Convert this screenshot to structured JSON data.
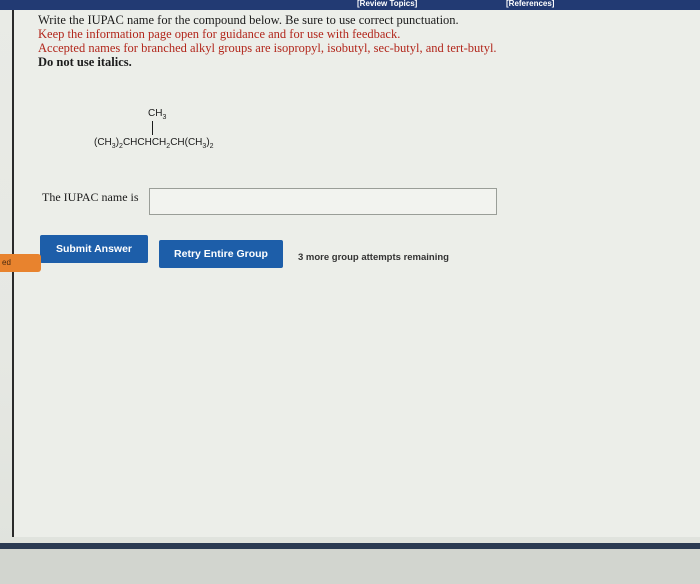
{
  "header": {
    "review_topics": "[Review Topics]",
    "references": "[References]"
  },
  "instructions": {
    "line1": "Write the IUPAC name for the compound below. Be sure to use correct punctuation.",
    "line2": "Keep the information page open for guidance and for use with feedback.",
    "line3": "Accepted names for branched alkyl groups are isopropyl, isobutyl, sec-butyl, and tert-butyl.",
    "line4": "Do not use italics."
  },
  "structure": {
    "branch": "CH3",
    "chain": "(CH3)2CHCHCH2CH(CH3)2"
  },
  "answer": {
    "label": "The IUPAC name is",
    "value": "",
    "placeholder": ""
  },
  "buttons": {
    "submit": "Submit Answer",
    "retry": "Retry Entire Group"
  },
  "attempts_text": "3 more group attempts remaining",
  "side_tab_label": "ed",
  "colors": {
    "top_bar": "#223a73",
    "button_blue": "#1d5ea9",
    "instruction_red": "#b2271c",
    "side_tab_orange": "#e8832e"
  }
}
